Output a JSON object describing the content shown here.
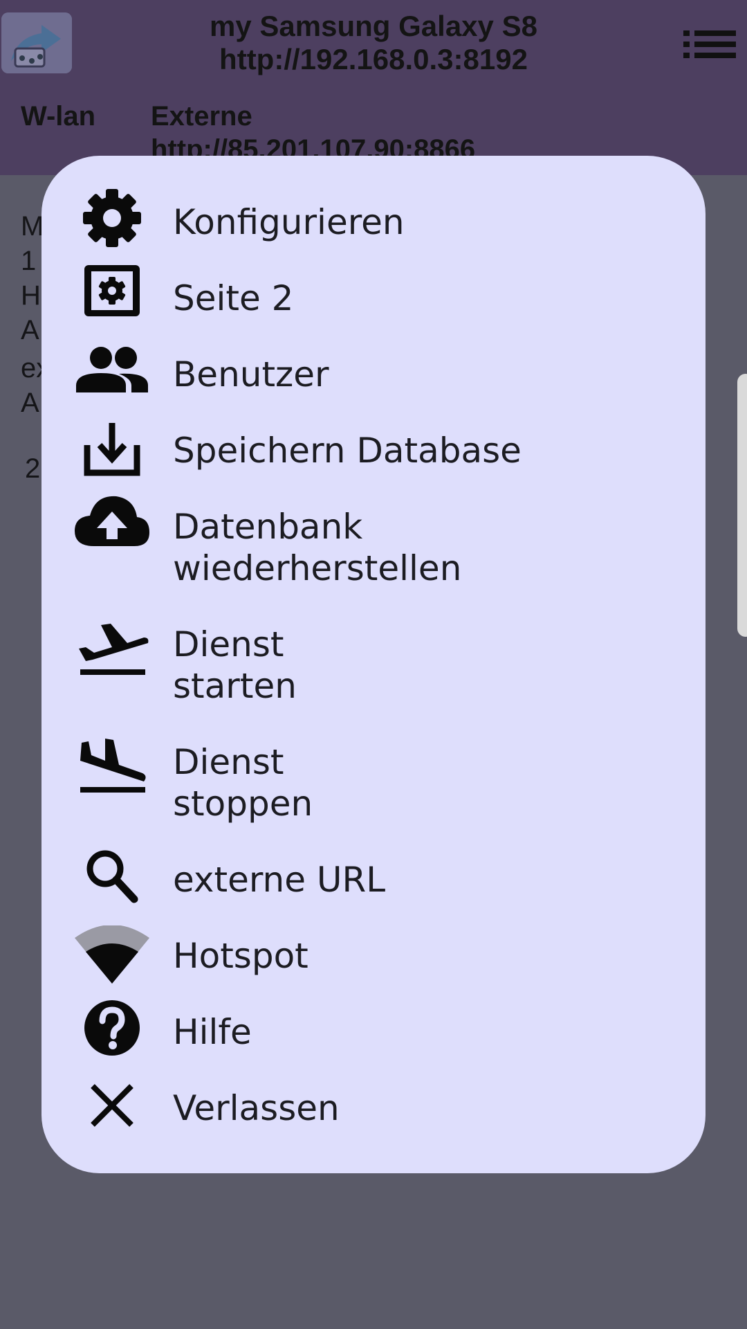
{
  "appbar": {
    "device_name": "my Samsung Galaxy S8",
    "local_url": "http://192.168.0.3:8192",
    "wlan_label": "W-lan",
    "external_label": "Externe",
    "external_url": "http://85.201.107.90:8866",
    "app_icon": "app-logo-icon",
    "menu_icon": "list-menu-icon"
  },
  "background": {
    "lines": [
      "M",
      "1",
      "H",
      "A",
      "ex",
      "A",
      "2"
    ],
    "scrim_color": "#5a5a68"
  },
  "menu": {
    "background_color": "#dedefc",
    "items": [
      {
        "icon": "gear-icon",
        "line1": "Konfigurieren",
        "line2": ""
      },
      {
        "icon": "settings-box-icon",
        "line1": "Seite 2",
        "line2": ""
      },
      {
        "icon": "users-icon",
        "line1": "Benutzer",
        "line2": ""
      },
      {
        "icon": "download-icon",
        "line1": "Speichern Database",
        "line2": ""
      },
      {
        "icon": "cloud-upload-icon",
        "line1": "Datenbank",
        "line2": "wiederherstellen"
      },
      {
        "icon": "flight-takeoff-icon",
        "line1": "Dienst",
        "line2": "starten"
      },
      {
        "icon": "flight-land-icon",
        "line1": "Dienst",
        "line2": "stoppen"
      },
      {
        "icon": "search-icon",
        "line1": "externe URL",
        "line2": ""
      },
      {
        "icon": "wifi-icon",
        "line1": "Hotspot",
        "line2": ""
      },
      {
        "icon": "help-icon",
        "line1": "Hilfe",
        "line2": ""
      },
      {
        "icon": "close-icon",
        "line1": "Verlassen",
        "line2": ""
      }
    ]
  }
}
